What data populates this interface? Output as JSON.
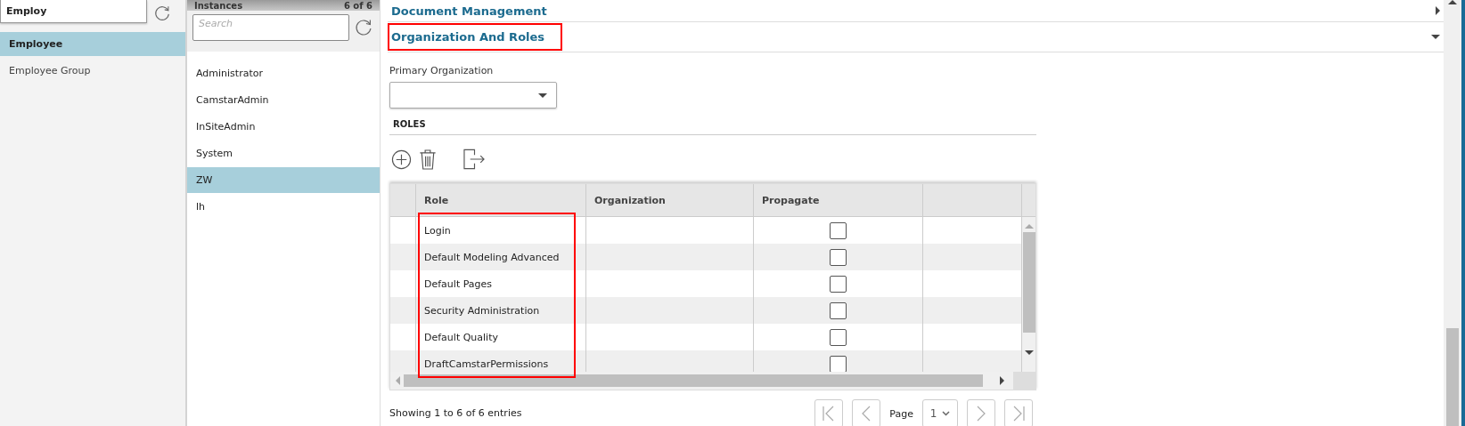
{
  "sidebar": {
    "search_value": "Employ",
    "items": [
      {
        "label": "Employee",
        "selected": true
      },
      {
        "label": "Employee Group",
        "selected": false
      }
    ]
  },
  "instances": {
    "title": "Instances",
    "count": "6 of 6",
    "placeholder": "Search",
    "items": [
      {
        "label": "Administrator",
        "selected": false
      },
      {
        "label": "CamstarAdmin",
        "selected": false
      },
      {
        "label": "InSiteAdmin",
        "selected": false
      },
      {
        "label": "System",
        "selected": false
      },
      {
        "label": "ZW",
        "selected": true
      },
      {
        "label": "lh",
        "selected": false
      }
    ]
  },
  "sections": [
    {
      "title": "Document Management",
      "expanded": false,
      "highlighted": false
    },
    {
      "title": "Organization And Roles",
      "expanded": true,
      "highlighted": true
    }
  ],
  "primary_organization": {
    "label": "Primary Organization"
  },
  "roles": {
    "title": "ROLES",
    "highlighted": true,
    "columns": [
      "Role",
      "Organization",
      "Propagate"
    ],
    "rows": [
      {
        "role": "Login",
        "propagate": false
      },
      {
        "role": "Default Modeling Advanced",
        "propagate": false
      },
      {
        "role": "Default Pages",
        "propagate": false
      },
      {
        "role": "Security Administration",
        "propagate": false
      },
      {
        "role": "Default Quality",
        "propagate": false
      },
      {
        "role": "DraftCamstarPermissions",
        "propagate": false
      }
    ]
  },
  "footer": "Showing 1 to 6 of 6 entries",
  "pager": {
    "label": "Page",
    "value": "1"
  }
}
